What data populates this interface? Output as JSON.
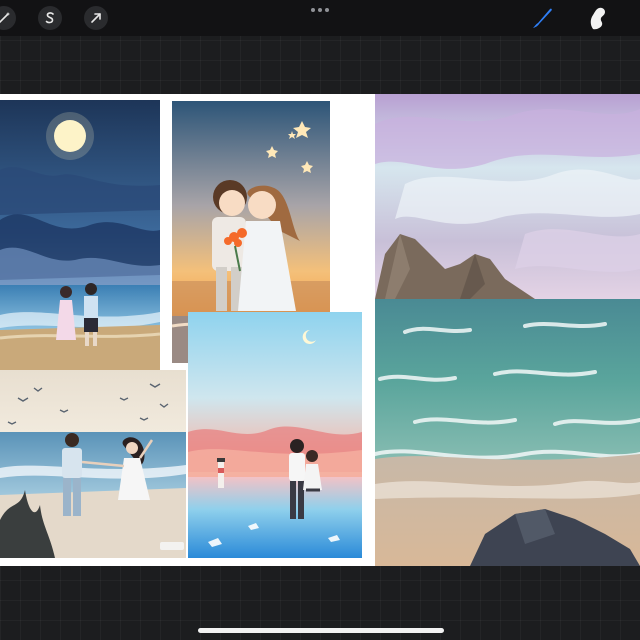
{
  "toolbar": {
    "left_tools": [
      {
        "icon": "magic-wand-icon"
      },
      {
        "icon": "selection-s-icon"
      },
      {
        "icon": "transform-arrow-icon"
      }
    ],
    "more_icon": "more-dots-icon",
    "right_tools": [
      {
        "icon": "brush-icon",
        "active": true,
        "color": "#2f7ff7"
      },
      {
        "icon": "smudge-icon",
        "active": false,
        "color": "#f2f2f2"
      }
    ]
  },
  "canvas": {
    "background": "#ffffff",
    "references": [
      {
        "name": "moonlit-beach-couple"
      },
      {
        "name": "sunset-children-with-flowers"
      },
      {
        "name": "seagull-beach-couple"
      },
      {
        "name": "pink-sky-lighthouse-couple"
      },
      {
        "name": "painted-seascape-with-rocks"
      }
    ],
    "watermark": "AI创作"
  },
  "colors": {
    "app_background": "#1c1d1f",
    "toolbar_background": "#121214",
    "accent": "#2f7ff7"
  }
}
